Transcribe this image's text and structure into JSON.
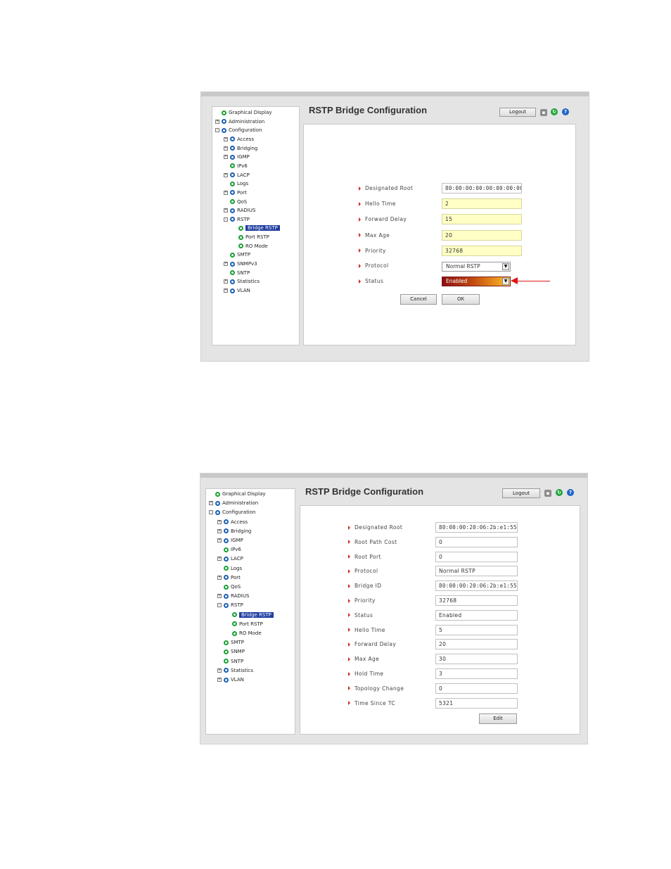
{
  "screen1": {
    "title": "RSTP Bridge Configuration",
    "logout_label": "Logout",
    "tree": [
      {
        "label": "Graphical Display",
        "exp": "",
        "dot": "green",
        "lvl": 0
      },
      {
        "label": "Administration",
        "exp": "+",
        "dot": "blue",
        "lvl": 0
      },
      {
        "label": "Configuration",
        "exp": "-",
        "dot": "blue",
        "lvl": 0
      },
      {
        "label": "Access",
        "exp": "+",
        "dot": "blue",
        "lvl": 1
      },
      {
        "label": "Bridging",
        "exp": "+",
        "dot": "blue",
        "lvl": 1
      },
      {
        "label": "IGMP",
        "exp": "+",
        "dot": "blue",
        "lvl": 1
      },
      {
        "label": "IPv6",
        "exp": "",
        "dot": "green",
        "lvl": 1
      },
      {
        "label": "LACP",
        "exp": "+",
        "dot": "blue",
        "lvl": 1
      },
      {
        "label": "Logs",
        "exp": "",
        "dot": "green",
        "lvl": 1
      },
      {
        "label": "Port",
        "exp": "+",
        "dot": "blue",
        "lvl": 1
      },
      {
        "label": "QoS",
        "exp": "",
        "dot": "green",
        "lvl": 1
      },
      {
        "label": "RADIUS",
        "exp": "+",
        "dot": "blue",
        "lvl": 1
      },
      {
        "label": "RSTP",
        "exp": "-",
        "dot": "blue",
        "lvl": 1
      },
      {
        "label": "Bridge RSTP",
        "exp": "",
        "dot": "green",
        "lvl": 2,
        "selected": true
      },
      {
        "label": "Port RSTP",
        "exp": "",
        "dot": "green",
        "lvl": 2
      },
      {
        "label": "RO Mode",
        "exp": "",
        "dot": "green",
        "lvl": 2
      },
      {
        "label": "SMTP",
        "exp": "",
        "dot": "green",
        "lvl": 1
      },
      {
        "label": "SNMPv3",
        "exp": "+",
        "dot": "blue",
        "lvl": 1
      },
      {
        "label": "SNTP",
        "exp": "",
        "dot": "green",
        "lvl": 1
      },
      {
        "label": "Statistics",
        "exp": "+",
        "dot": "blue",
        "lvl": 1
      },
      {
        "label": "VLAN",
        "exp": "+",
        "dot": "blue",
        "lvl": 1
      }
    ],
    "fields": [
      {
        "label": "Designated Root",
        "value": "80:00:00:00:00:00:00:00",
        "editable": false
      },
      {
        "label": "Hello Time",
        "value": "2",
        "editable": true
      },
      {
        "label": "Forward Delay",
        "value": "15",
        "editable": true
      },
      {
        "label": "Max Age",
        "value": "20",
        "editable": true
      },
      {
        "label": "Priority",
        "value": "32768",
        "editable": true
      }
    ],
    "protocol_label": "Protocol",
    "protocol_value": "Normal RSTP",
    "status_label": "Status",
    "status_value": "Enabled",
    "cancel_label": "Cancel",
    "ok_label": "OK"
  },
  "screen2": {
    "title": "RSTP Bridge Configuration",
    "logout_label": "Logout",
    "tree": [
      {
        "label": "Graphical Display",
        "exp": "",
        "dot": "green",
        "lvl": 0
      },
      {
        "label": "Administration",
        "exp": "+",
        "dot": "blue",
        "lvl": 0
      },
      {
        "label": "Configuration",
        "exp": "-",
        "dot": "blue",
        "lvl": 0
      },
      {
        "label": "Access",
        "exp": "+",
        "dot": "blue",
        "lvl": 1
      },
      {
        "label": "Bridging",
        "exp": "+",
        "dot": "blue",
        "lvl": 1
      },
      {
        "label": "IGMP",
        "exp": "+",
        "dot": "blue",
        "lvl": 1
      },
      {
        "label": "IPv6",
        "exp": "",
        "dot": "green",
        "lvl": 1
      },
      {
        "label": "LACP",
        "exp": "+",
        "dot": "blue",
        "lvl": 1
      },
      {
        "label": "Logs",
        "exp": "",
        "dot": "green",
        "lvl": 1
      },
      {
        "label": "Port",
        "exp": "+",
        "dot": "blue",
        "lvl": 1
      },
      {
        "label": "QoS",
        "exp": "",
        "dot": "green",
        "lvl": 1
      },
      {
        "label": "RADIUS",
        "exp": "+",
        "dot": "blue",
        "lvl": 1
      },
      {
        "label": "RSTP",
        "exp": "-",
        "dot": "blue",
        "lvl": 1
      },
      {
        "label": "Bridge RSTP",
        "exp": "",
        "dot": "green",
        "lvl": 2,
        "selected": true
      },
      {
        "label": "Port RSTP",
        "exp": "",
        "dot": "green",
        "lvl": 2
      },
      {
        "label": "RO Mode",
        "exp": "",
        "dot": "green",
        "lvl": 2
      },
      {
        "label": "SMTP",
        "exp": "",
        "dot": "green",
        "lvl": 1
      },
      {
        "label": "SNMP",
        "exp": "",
        "dot": "green",
        "lvl": 1
      },
      {
        "label": "SNTP",
        "exp": "",
        "dot": "green",
        "lvl": 1
      },
      {
        "label": "Statistics",
        "exp": "+",
        "dot": "blue",
        "lvl": 1
      },
      {
        "label": "VLAN",
        "exp": "+",
        "dot": "blue",
        "lvl": 1
      }
    ],
    "fields": [
      {
        "label": "Designated Root",
        "value": "80:00:00:20:06:2b:e1:55"
      },
      {
        "label": "Root Path Cost",
        "value": "0"
      },
      {
        "label": "Root Port",
        "value": "0"
      },
      {
        "label": "Protocol",
        "value": "Normal RSTP"
      },
      {
        "label": "Bridge ID",
        "value": "80:00:00:20:06:2b:e1:55"
      },
      {
        "label": "Priority",
        "value": "32768"
      },
      {
        "label": "Status",
        "value": "Enabled"
      },
      {
        "label": "Hello Time",
        "value": "5"
      },
      {
        "label": "Forward Delay",
        "value": "20"
      },
      {
        "label": "Max Age",
        "value": "30"
      },
      {
        "label": "Hold Time",
        "value": "3"
      },
      {
        "label": "Topology Change",
        "value": "0"
      },
      {
        "label": "Time Since TC",
        "value": "5321"
      }
    ],
    "edit_label": "Edit"
  },
  "colors": {
    "accent_arrow": "#e01515",
    "selected_bg": "#1f3ea0",
    "editable_bg": "#ffffc6"
  }
}
